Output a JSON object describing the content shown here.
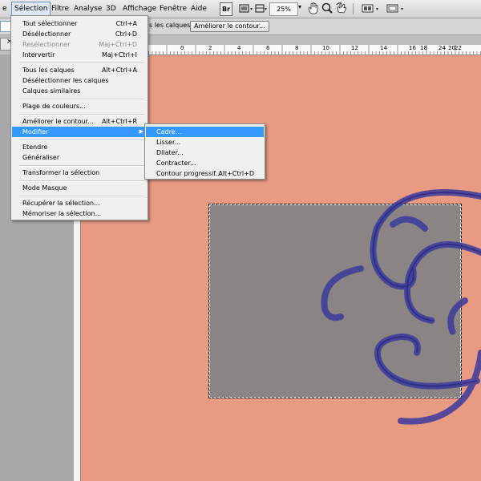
{
  "menubar": {
    "items": [
      "e",
      "Sélection",
      "Filtre",
      "Analyse",
      "3D",
      "Affichage",
      "Fenêtre",
      "Aide"
    ],
    "br_label": "Br",
    "zoom": "25%",
    "arrow": "▾"
  },
  "options": {
    "partial_label": "s les calques",
    "refine_button": "Améliorer le contour..."
  },
  "tabstrip": {
    "close": "×"
  },
  "ruler": {
    "numbers": [
      "0",
      "2",
      "4",
      "6",
      "8",
      "10",
      "12",
      "14",
      "16",
      "18",
      "20",
      "22",
      "24"
    ]
  },
  "selection_menu": {
    "items": [
      {
        "label": "Tout sélectionner",
        "shortcut": "Ctrl+A"
      },
      {
        "label": "Désélectionner",
        "shortcut": "Ctrl+D"
      },
      {
        "label": "Resélectionner",
        "shortcut": "Maj+Ctrl+D"
      },
      {
        "label": "Intervertir",
        "shortcut": "Maj+Ctrl+I"
      },
      {
        "label": "Tous les calques",
        "shortcut": "Alt+Ctrl+A"
      },
      {
        "label": "Désélectionner les calques",
        "shortcut": ""
      },
      {
        "label": "Calques similaires",
        "shortcut": ""
      },
      {
        "label": "Plage de couleurs...",
        "shortcut": ""
      },
      {
        "label": "Améliorer le contour...",
        "shortcut": "Alt+Ctrl+R"
      },
      {
        "label": "Modifier",
        "shortcut": ""
      },
      {
        "label": "Etendre",
        "shortcut": ""
      },
      {
        "label": "Généraliser",
        "shortcut": ""
      },
      {
        "label": "Transformer la sélection",
        "shortcut": ""
      },
      {
        "label": "Mode Masque",
        "shortcut": ""
      },
      {
        "label": "Récupérer la sélection...",
        "shortcut": ""
      },
      {
        "label": "Mémoriser la sélection...",
        "shortcut": ""
      }
    ],
    "submenu_arrow": "▶"
  },
  "modify_submenu": {
    "items": [
      {
        "label": "Cadre...",
        "shortcut": ""
      },
      {
        "label": "Lisser...",
        "shortcut": ""
      },
      {
        "label": "Dilater...",
        "shortcut": ""
      },
      {
        "label": "Contracter...",
        "shortcut": ""
      },
      {
        "label": "Contour progressif...",
        "shortcut": "Alt+Ctrl+D"
      }
    ]
  },
  "colors": {
    "canvas": "#e89a83",
    "selection_fill": "#8a8584",
    "highlight": "#3399ff",
    "swirl": "#3a3a9a"
  }
}
